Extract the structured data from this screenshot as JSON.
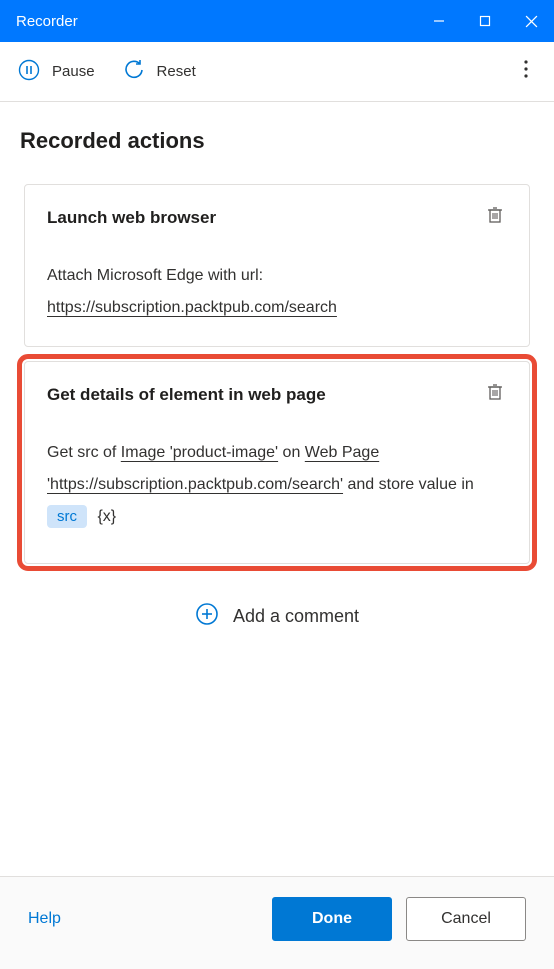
{
  "titlebar": {
    "title": "Recorder"
  },
  "toolbar": {
    "pause_label": "Pause",
    "reset_label": "Reset"
  },
  "page": {
    "heading": "Recorded actions"
  },
  "cards": [
    {
      "title": "Launch web browser",
      "line1_pre": "Attach Microsoft Edge with url:",
      "url": "https://subscription.packtpub.com/search",
      "highlighted": false
    },
    {
      "title": "Get details of element in web page",
      "d_pre": "Get src of ",
      "d_element": "Image 'product-image'",
      "d_mid": " on ",
      "d_page": "Web Page 'https://subscription.packtpub.com/search'",
      "d_tail": " and store value in ",
      "d_var": "src",
      "d_varhint": "{x}",
      "highlighted": true
    }
  ],
  "addcomment_label": "Add a comment",
  "footer": {
    "help": "Help",
    "done": "Done",
    "cancel": "Cancel"
  }
}
